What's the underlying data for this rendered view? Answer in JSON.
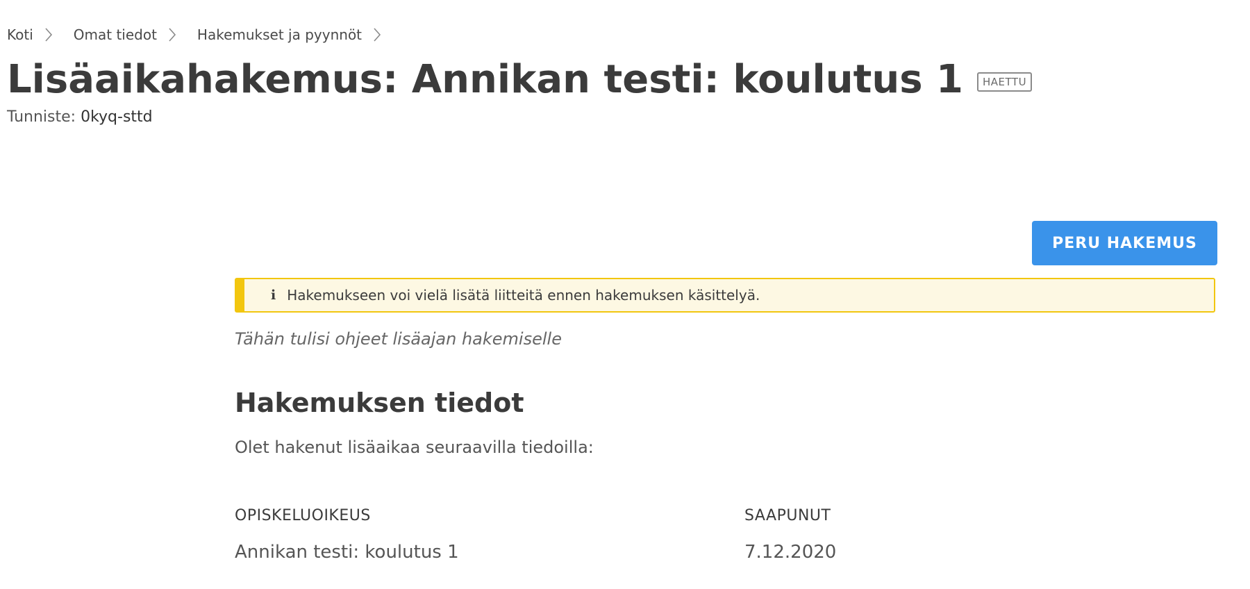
{
  "breadcrumb": {
    "items": [
      "Koti",
      "Omat tiedot",
      "Hakemukset ja pyynnöt"
    ]
  },
  "header": {
    "title": "Lisäaikahakemus: Annikan testi: koulutus 1",
    "status_tag": "HAETTU",
    "identifier_label": "Tunniste:",
    "identifier_value": "0kyq-sttd"
  },
  "actions": {
    "cancel_label": "PERU HAKEMUS"
  },
  "notice": {
    "icon": "info-icon",
    "text": "Hakemukseen voi vielä lisätä liitteitä ennen hakemuksen käsittelyä."
  },
  "instructions": "Tähän tulisi ohjeet lisäajan hakemiselle",
  "details": {
    "heading": "Hakemuksen tiedot",
    "description": "Olet hakenut lisäaikaa seuraavilla tiedoilla:",
    "columns": [
      {
        "header": "OPISKELUOIKEUS",
        "value": "Annikan testi: koulutus 1"
      },
      {
        "header": "SAAPUNUT",
        "value": "7.12.2020"
      }
    ]
  },
  "colors": {
    "button": "#3a93ea",
    "notice_border": "#f2c60f",
    "notice_bg": "#fdf8e3"
  }
}
